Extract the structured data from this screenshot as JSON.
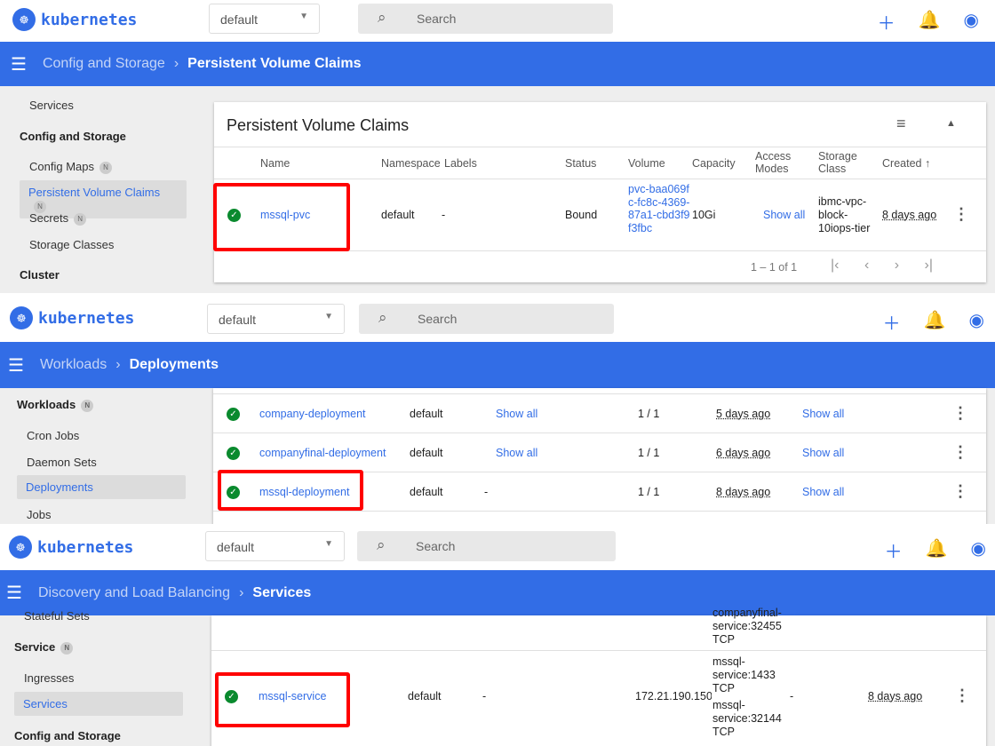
{
  "brand": "kubernetes",
  "namespace": "default",
  "search_placeholder": "Search",
  "colors": {
    "accent": "#326de6",
    "success": "#0a8a2e",
    "highlight": "#ff0000"
  },
  "panels": [
    {
      "breadcrumb": {
        "parent": "Config and Storage",
        "current": "Persistent Volume Claims"
      },
      "sidebar": [
        {
          "label": "Services"
        },
        {
          "label": "Config and Storage",
          "heading": true
        },
        {
          "label": "Config Maps",
          "badge": "N"
        },
        {
          "label": "Persistent Volume Claims",
          "badge": "N",
          "active": true
        },
        {
          "label": "Secrets",
          "badge": "N"
        },
        {
          "label": "Storage Classes"
        },
        {
          "label": "Cluster",
          "heading": true
        }
      ],
      "card_title": "Persistent Volume Claims",
      "columns": [
        "Name",
        "Namespace",
        "Labels",
        "Status",
        "Volume",
        "Capacity",
        "Access Modes",
        "Storage Class",
        "Created ↑"
      ],
      "row": {
        "name": "mssql-pvc",
        "namespace": "default",
        "labels": "-",
        "status": "Bound",
        "volume": "pvc-baa069fc-fc8c-4369-87a1-cbd3f9f3fbc",
        "capacity": "10Gi",
        "access_modes": "Show all",
        "storage_class": "ibmc-vpc-block-10iops-tier",
        "created": "8 days ago"
      },
      "pagination": "1 – 1 of 1"
    },
    {
      "breadcrumb": {
        "parent": "Workloads",
        "current": "Deployments"
      },
      "sidebar": [
        {
          "label": "Workloads",
          "heading": true,
          "badge": "N"
        },
        {
          "label": "Cron Jobs"
        },
        {
          "label": "Daemon Sets"
        },
        {
          "label": "Deployments",
          "active": true
        },
        {
          "label": "Jobs"
        }
      ],
      "rows": [
        {
          "name": "company-deployment",
          "namespace": "default",
          "labels": "Show all",
          "pods": "1 / 1",
          "created": "5 days ago",
          "images": "Show all"
        },
        {
          "name": "companyfinal-deployment",
          "namespace": "default",
          "labels": "Show all",
          "pods": "1 / 1",
          "created": "6 days ago",
          "images": "Show all"
        },
        {
          "name": "mssql-deployment",
          "namespace": "default",
          "labels": "-",
          "pods": "1 / 1",
          "created": "8 days ago",
          "images": "Show all"
        }
      ]
    },
    {
      "breadcrumb": {
        "parent": "Discovery and Load Balancing",
        "current": "Services"
      },
      "sidebar": [
        {
          "label": "Stateful Sets"
        },
        {
          "label": "Service",
          "heading": true,
          "badge": "N"
        },
        {
          "label": "Ingresses"
        },
        {
          "label": "Services",
          "active": true
        },
        {
          "label": "Config and Storage",
          "heading": true
        }
      ],
      "prev_row_endpoint": "companyfinal-service:32455 TCP",
      "row": {
        "name": "mssql-service",
        "namespace": "default",
        "labels": "-",
        "cluster_ip": "172.21.190.150",
        "endpoint1": "mssql-service:1433 TCP",
        "endpoint2": "mssql-service:32144 TCP",
        "external": "-",
        "created": "8 days ago"
      }
    }
  ]
}
